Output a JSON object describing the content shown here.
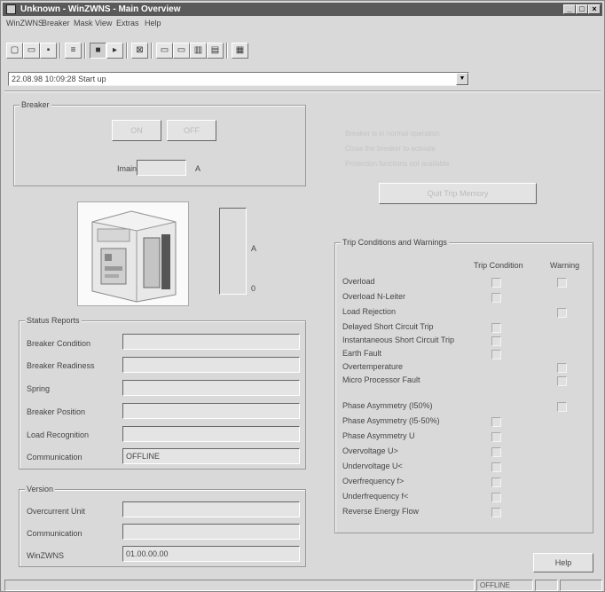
{
  "window": {
    "title": "Unknown - WinZWNS - Main Overview",
    "buttons": {
      "minimize": "_",
      "maximize": "□",
      "close": "×"
    }
  },
  "menu": {
    "items": [
      "WinZWNS",
      "Breaker",
      "Mask",
      "View",
      "Extras",
      "Help"
    ]
  },
  "toolbar": {
    "icons": [
      "new-file-icon",
      "open-file-icon",
      "save-icon",
      "print-icon",
      "stop-icon",
      "play-icon",
      "overview-icon",
      "window-1-icon",
      "window-2-icon",
      "window-3-icon",
      "window-4-icon",
      "calculator-icon"
    ]
  },
  "event_select": {
    "value": "22.08.98  10:09:28  Start up"
  },
  "breaker_group": {
    "title": "Breaker",
    "button_on": "ON",
    "button_off": "OFF",
    "imain_label": "Imain",
    "imain_unit": "A",
    "imain_value": ""
  },
  "info_text": {
    "line1": "Breaker is in normal operation",
    "line2": "Close the breaker to activate",
    "line3": "Protection functions not available"
  },
  "action_button": "Quit Trip Memory",
  "scale": {
    "top_label": "A",
    "bottom_label": "0"
  },
  "status_reports": {
    "title": "Status Reports",
    "rows": [
      {
        "label": "Breaker Condition",
        "value": ""
      },
      {
        "label": "Breaker Readiness",
        "value": ""
      },
      {
        "label": "Spring",
        "value": ""
      },
      {
        "label": "Breaker Position",
        "value": ""
      },
      {
        "label": "Load Recognition",
        "value": ""
      },
      {
        "label": "Communication",
        "value": "OFFLINE"
      }
    ]
  },
  "version": {
    "title": "Version",
    "rows": [
      {
        "label": "Overcurrent Unit",
        "value": ""
      },
      {
        "label": "Communication",
        "value": ""
      },
      {
        "label": "WinZWNS",
        "value": "01.00.00.00"
      }
    ]
  },
  "trip_conditions": {
    "title": "Trip Conditions and Warnings",
    "col_trip": "Trip Condition",
    "col_warning": "Warning",
    "rows": [
      {
        "label": "Overload",
        "trip": true,
        "warning": true
      },
      {
        "label": "Overload N-Leiter",
        "trip": true,
        "warning": false
      },
      {
        "label": "Load Rejection",
        "trip": false,
        "warning": true
      },
      {
        "label": "Delayed Short Circuit Trip",
        "trip": true,
        "warning": false
      },
      {
        "label": "Instantaneous Short Circuit Trip",
        "trip": true,
        "warning": false
      },
      {
        "label": "Earth Fault",
        "trip": true,
        "warning": false
      },
      {
        "label": "Overtemperature",
        "trip": false,
        "warning": true
      },
      {
        "label": "Micro Processor Fault",
        "trip": false,
        "warning": true
      },
      {
        "label": "Phase Asymmetry (I50%)",
        "trip": false,
        "warning": true
      },
      {
        "label": "Phase Asymmetry (I5-50%)",
        "trip": true,
        "warning": false
      },
      {
        "label": "Phase Asymmetry U",
        "trip": true,
        "warning": false
      },
      {
        "label": "Overvoltage U>",
        "trip": true,
        "warning": false
      },
      {
        "label": "Undervoltage U<",
        "trip": true,
        "warning": false
      },
      {
        "label": "Overfrequency f>",
        "trip": true,
        "warning": false
      },
      {
        "label": "Underfrequency f<",
        "trip": true,
        "warning": false
      },
      {
        "label": "Reverse Energy Flow",
        "trip": true,
        "warning": false
      }
    ]
  },
  "help_button": "Help",
  "statusbar": {
    "text": "OFFLINE"
  }
}
